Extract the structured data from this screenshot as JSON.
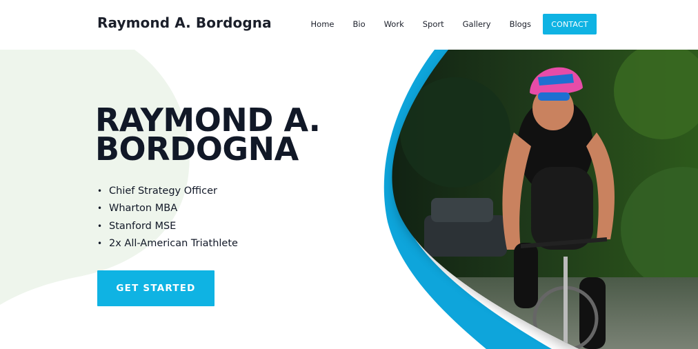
{
  "brand": {
    "name": "Raymond A. Bordogna"
  },
  "nav": {
    "items": [
      "Home",
      "Bio",
      "Work",
      "Sport",
      "Gallery",
      "Blogs"
    ],
    "contact_label": "CONTACT"
  },
  "hero": {
    "title": "RAYMOND A.\nBORDOGNA",
    "bullets": [
      "Chief Strategy Officer",
      "Wharton MBA",
      "Stanford MSE",
      "2x All-American Triathlete"
    ],
    "cta_label": "GET STARTED",
    "photo_subject": "cyclist-photo"
  },
  "colors": {
    "accent": "#0fb3e3",
    "text": "#111827",
    "blob": "#eef5ec"
  }
}
